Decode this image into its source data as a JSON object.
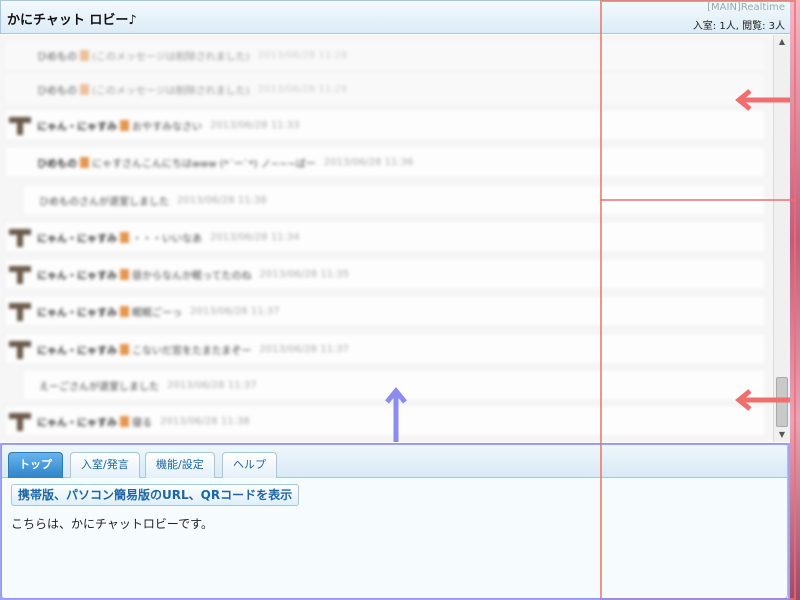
{
  "header": {
    "title": "かにチャット ロビー♪",
    "mode": "[MAIN]Realtime",
    "counts": "入室: 1人, 閲覧: 3人"
  },
  "log": {
    "rows": [
      {
        "kind": "faint",
        "name": "ひめもの",
        "msg": "(このメッセージは削除されました)",
        "time": "2013/06/28 11:28"
      },
      {
        "kind": "faint",
        "name": "ひめもの",
        "msg": "(このメッセージは削除されました)",
        "time": "2013/06/28 11:29"
      },
      {
        "kind": "user",
        "name": "にゃん・にゃすみ",
        "msg": "おやすみなさい",
        "time": "2013/06/28 11:33"
      },
      {
        "kind": "user2",
        "name": "ひめもの",
        "msg": "にゃすさんこんにちはwww (*´ー`*) ノ~~~ばー",
        "time": "2013/06/28 11:36"
      },
      {
        "kind": "sys",
        "name": "",
        "msg": "ひめものさんが退室しました",
        "time": "2013/06/28 11:38"
      },
      {
        "kind": "user",
        "name": "にゃん・にゃすみ",
        "msg": "・・・いいなあ",
        "time": "2013/06/28 11:34"
      },
      {
        "kind": "user",
        "name": "にゃん・にゃすみ",
        "msg": "昼からなんか眠ってたのね",
        "time": "2013/06/28 11:35"
      },
      {
        "kind": "user",
        "name": "にゃん・にゃすみ",
        "msg": "眠眠ごーっ",
        "time": "2013/06/28 11:37"
      },
      {
        "kind": "user",
        "name": "にゃん・にゃすみ",
        "msg": "こないだ窓をたまたまぞー",
        "time": "2013/06/28 11:37"
      },
      {
        "kind": "sys",
        "name": "",
        "msg": "えーごさんが退室しました",
        "time": "2013/06/28 11:37"
      },
      {
        "kind": "user",
        "name": "にゃん・にゃすみ",
        "msg": "寝る",
        "time": "2013/06/28 11:38"
      }
    ]
  },
  "panel": {
    "tabs": [
      {
        "label": "トップ",
        "active": true
      },
      {
        "label": "入室/発言",
        "active": false
      },
      {
        "label": "機能/設定",
        "active": false
      },
      {
        "label": "ヘルプ",
        "active": false
      }
    ],
    "qr_button": "携帯版、パソコン簡易版のURL、QRコードを表示",
    "description": "こちらは、かにチャットロビーです。"
  },
  "colors": {
    "accent": "#2c84c9",
    "annotation_red": "#f06e6e",
    "annotation_blue": "#8c8cf0",
    "sidebar_pink": "#c05d7d"
  },
  "icons": {
    "avatar": "mushroom-avatar-icon",
    "scroll_up": "triangle-up-icon",
    "scroll_down": "triangle-down-icon",
    "arrow": "arrow-left-icon"
  }
}
